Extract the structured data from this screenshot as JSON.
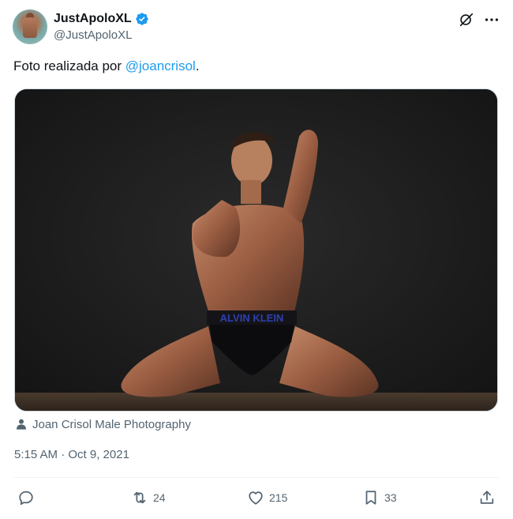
{
  "author": {
    "display_name": "JustApoloXL",
    "handle": "@JustApoloXL",
    "verified_color": "#1d9bf0"
  },
  "tweet": {
    "text_prefix": "Foto realizada por ",
    "mention": "@joancrisol",
    "text_suffix": "."
  },
  "media": {
    "underwear_brand_text": "ALVIN KLEIN",
    "credit_label": "Joan Crisol Male Photography"
  },
  "meta": {
    "timestamp": "5:15 AM · Oct 9, 2021"
  },
  "actions": {
    "reply_count": "",
    "retweet_count": "24",
    "like_count": "215",
    "bookmark_count": "33"
  },
  "colors": {
    "accent": "#1d9bf0",
    "secondary_text": "#536471",
    "border": "#cfd9de"
  },
  "icons": [
    "grok-icon",
    "more-icon",
    "person-icon",
    "reply-icon",
    "retweet-icon",
    "like-icon",
    "bookmark-icon",
    "share-icon",
    "verified-badge-icon"
  ]
}
